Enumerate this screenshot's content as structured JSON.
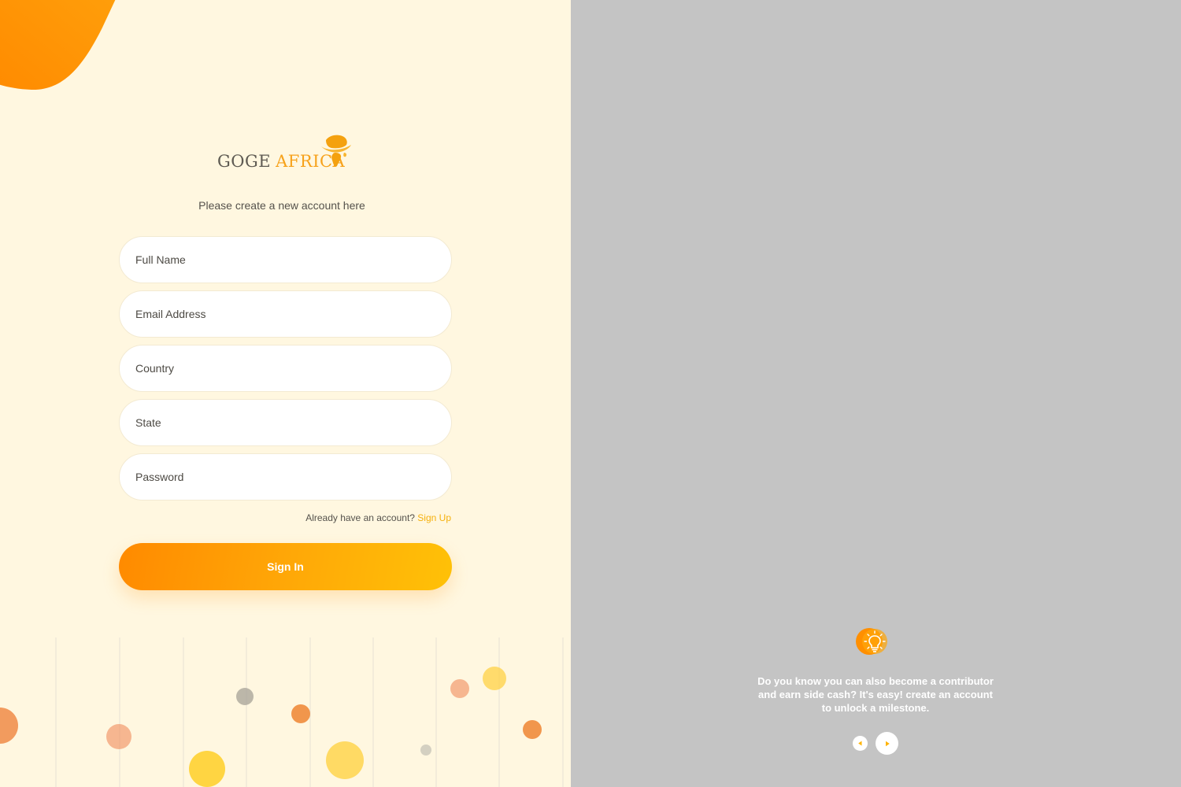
{
  "brand": {
    "name_part1": "GOGE",
    "name_part2": "AFRICA",
    "primary_color": "#ff8a00",
    "accent_color": "#ffc107",
    "background_color": "#fff7e0",
    "icon": "africa-safari-hat-logo-icon"
  },
  "form": {
    "subtitle": "Please create a new account here",
    "fields": [
      {
        "name": "full-name",
        "placeholder": "Full Name",
        "value": ""
      },
      {
        "name": "email-address",
        "placeholder": "Email Address",
        "value": ""
      },
      {
        "name": "country",
        "placeholder": "Country",
        "value": ""
      },
      {
        "name": "state",
        "placeholder": "State",
        "value": ""
      },
      {
        "name": "password",
        "placeholder": "Password",
        "value": ""
      }
    ],
    "account_prompt": "Already have an account?",
    "signup_link": "Sign Up",
    "submit_label": "Sign In"
  },
  "tip": {
    "icon": "lightbulb-icon",
    "text": "Do you know you can also become a contributor and earn side cash? It's easy! create an account to unlock a milestone.",
    "prev_icon": "chevron-left-icon",
    "next_icon": "chevron-right-icon"
  }
}
